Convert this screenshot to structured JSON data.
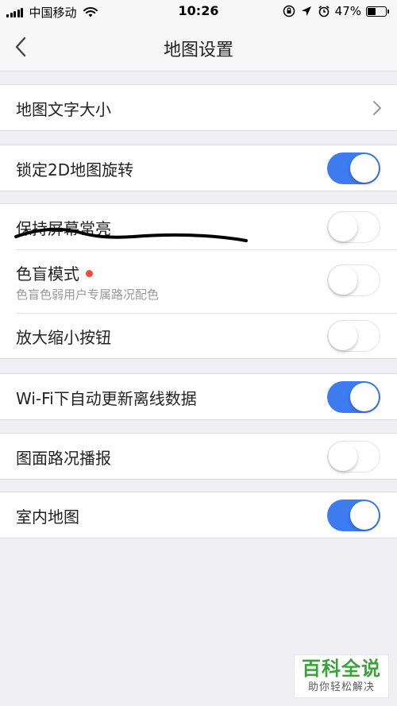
{
  "status_bar": {
    "carrier": "中国移动",
    "time": "10:26",
    "battery_percent": "47%",
    "battery_level": 0.47
  },
  "nav": {
    "title": "地图设置"
  },
  "settings": {
    "font_size": {
      "label": "地图文字大小"
    },
    "lock_2d": {
      "label": "锁定2D地图旋转",
      "enabled": true
    },
    "keep_screen_on": {
      "label": "保持屏幕常亮",
      "enabled": false
    },
    "color_blind": {
      "label": "色盲模式",
      "sublabel": "色盲色弱用户专属路况配色",
      "enabled": false
    },
    "zoom_buttons": {
      "label": "放大缩小按钮",
      "enabled": false
    },
    "wifi_update": {
      "label": "Wi-Fi下自动更新离线数据",
      "enabled": true
    },
    "traffic_broadcast": {
      "label": "图面路况播报",
      "enabled": false
    },
    "indoor_map": {
      "label": "室内地图",
      "enabled": true
    }
  },
  "colors": {
    "toggle_on": "#3c7cf0",
    "new_dot": "#f04a3d",
    "background": "#efeff4"
  },
  "watermark": {
    "title": "百科全说",
    "subtitle": "助你轻松解决"
  }
}
